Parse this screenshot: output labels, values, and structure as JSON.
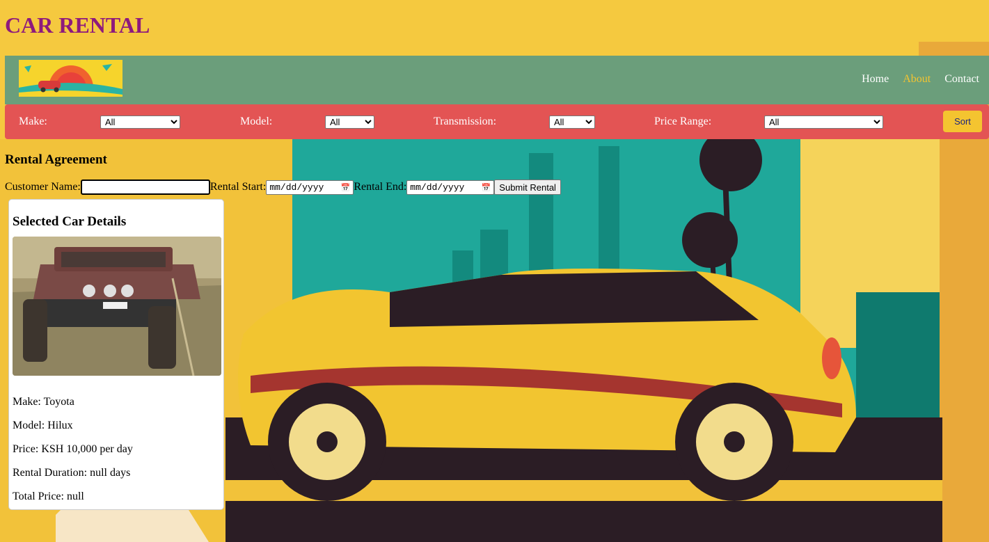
{
  "site": {
    "title": "CAR RENTAL"
  },
  "nav": {
    "links": [
      "Home",
      "About",
      "Contact"
    ],
    "active": "About"
  },
  "filters": {
    "make_label": "Make:",
    "make_value": "All",
    "model_label": "Model:",
    "model_value": "All",
    "transmission_label": "Transmission:",
    "transmission_value": "All",
    "price_label": "Price Range:",
    "price_value": "All",
    "sort_label": "Sort"
  },
  "rental": {
    "heading": "Rental Agreement",
    "customer_label": "Customer Name:",
    "customer_value": "",
    "start_label": "Rental Start:",
    "start_placeholder": "mm/dd/yyyy",
    "end_label": "Rental End:",
    "end_placeholder": "mm/dd/yyyy",
    "submit_label": "Submit Rental"
  },
  "details": {
    "heading": "Selected Car Details",
    "make": "Make: Toyota",
    "model": "Model: Hilux",
    "price": "Price: KSH 10,000 per day",
    "duration": "Rental Duration: null days",
    "total": "Total Price: null"
  },
  "colors": {
    "title": "#8e1a7d",
    "navbar": "#6b9e7b",
    "filterbar": "#e35454",
    "accent": "#f4c430",
    "sort_text": "#1a237e"
  }
}
